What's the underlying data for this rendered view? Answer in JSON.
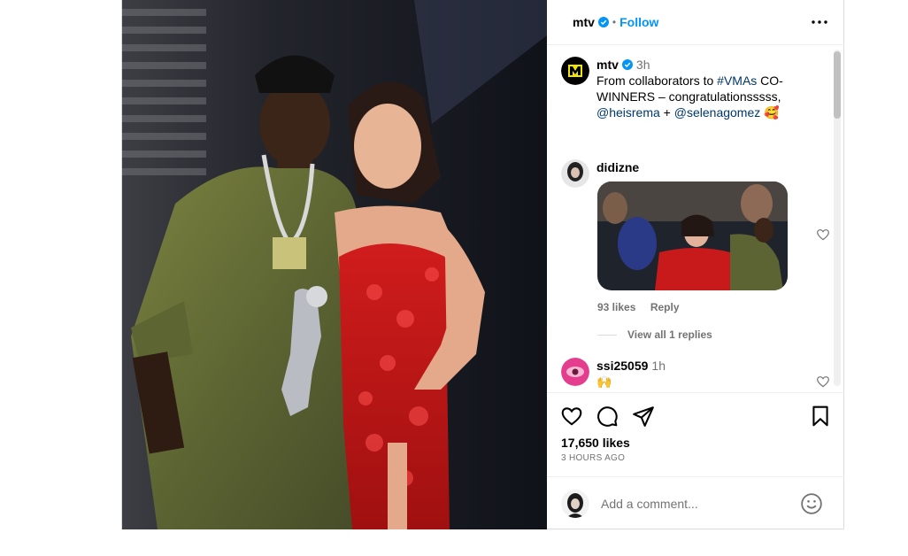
{
  "colors": {
    "accent": "#0095f6",
    "link": "#00376b",
    "muted": "#737373",
    "border": "#dbdbdb"
  },
  "header": {
    "username": "mtv",
    "separator": "•",
    "follow_label": "Follow",
    "more_icon": "more-horizontal-icon"
  },
  "caption": {
    "username": "mtv",
    "time": "3h",
    "text_1": "From collaborators to ",
    "hashtag": "#VMAs",
    "text_2": " CO-WINNERS – congratulationsssss,",
    "mention_1": "@heisrema",
    "plus": " + ",
    "mention_2": "@selenagomez",
    "emoji": "🥰"
  },
  "comments": [
    {
      "username": "didizne",
      "has_image": true,
      "likes": "93 likes",
      "reply_label": "Reply",
      "view_replies": "View all 1 replies"
    },
    {
      "username": "ssi25059",
      "time": "1h",
      "text": "🙌"
    }
  ],
  "footer": {
    "likes": "17,650 likes",
    "time_ago": "3 HOURS AGO",
    "comment_placeholder": "Add a comment..."
  }
}
